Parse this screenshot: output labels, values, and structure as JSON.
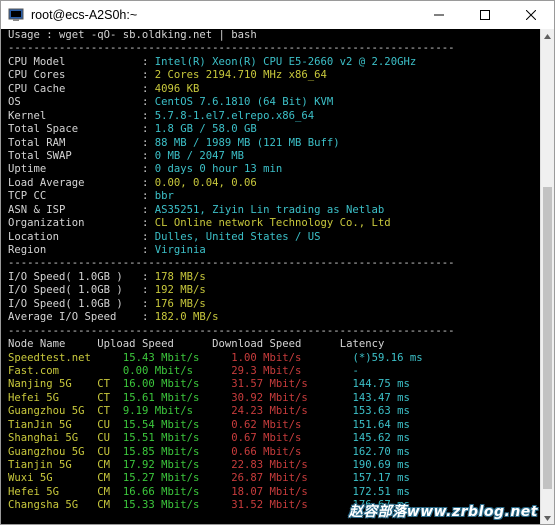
{
  "window": {
    "title": "root@ecs-A2S0h:~"
  },
  "usage": "Usage : wget -qO- sb.oldking.net | bash",
  "separator": "----------------------------------------------------------------------",
  "sysinfo": [
    {
      "label": "CPU Model",
      "value": "Intel(R) Xeon(R) CPU E5-2660 v2 @ 2.20GHz"
    },
    {
      "label": "CPU Cores",
      "value": "2 Cores 2194.710 MHz x86_64"
    },
    {
      "label": "CPU Cache",
      "value": "4096 KB"
    },
    {
      "label": "OS",
      "value": "CentOS 7.6.1810 (64 Bit) KVM"
    },
    {
      "label": "Kernel",
      "value": "5.7.8-1.el7.elrepo.x86_64"
    },
    {
      "label": "Total Space",
      "value": "1.8 GB / 58.0 GB"
    },
    {
      "label": "Total RAM",
      "value": "88 MB / 1989 MB (121 MB Buff)"
    },
    {
      "label": "Total SWAP",
      "value": "0 MB / 2047 MB"
    },
    {
      "label": "Uptime",
      "value": "0 days 0 hour 13 min"
    },
    {
      "label": "Load Average",
      "value": "0.00, 0.04, 0.06"
    },
    {
      "label": "TCP CC",
      "value": "bbr"
    },
    {
      "label": "ASN & ISP",
      "value": "AS35251, Ziyin Lin trading as Netlab"
    },
    {
      "label": "Organization",
      "value": "CL Online network Technology Co., Ltd"
    },
    {
      "label": "Location",
      "value": "Dulles, United States / US"
    },
    {
      "label": "Region",
      "value": "Virginia"
    }
  ],
  "io": [
    {
      "label": "I/O Speed( 1.0GB )",
      "value": "178 MB/s"
    },
    {
      "label": "I/O Speed( 1.0GB )",
      "value": "192 MB/s"
    },
    {
      "label": "I/O Speed( 1.0GB )",
      "value": "176 MB/s"
    },
    {
      "label": "Average I/O Speed",
      "value": "182.0 MB/s"
    }
  ],
  "speedtest": {
    "headers": [
      "Node Name",
      "Upload Speed",
      "Download Speed",
      "Latency"
    ],
    "rows": [
      {
        "node": "Speedtest.net",
        "tag": "",
        "up": "15.43 Mbit/s",
        "down": "1.00 Mbit/s",
        "lat": "(*)59.16 ms"
      },
      {
        "node": "Fast.com",
        "tag": "",
        "up": "0.00 Mbit/s",
        "down": "29.3 Mbit/s",
        "lat": "-"
      },
      {
        "node": "Nanjing 5G",
        "tag": "CT",
        "up": "16.00 Mbit/s",
        "down": "31.57 Mbit/s",
        "lat": "144.75 ms"
      },
      {
        "node": "Hefei 5G",
        "tag": "CT",
        "up": "15.61 Mbit/s",
        "down": "30.92 Mbit/s",
        "lat": "143.47 ms"
      },
      {
        "node": "Guangzhou 5G",
        "tag": "CT",
        "up": "9.19 Mbit/s",
        "down": "24.23 Mbit/s",
        "lat": "153.63 ms"
      },
      {
        "node": "TianJin 5G",
        "tag": "CU",
        "up": "15.54 Mbit/s",
        "down": "0.62 Mbit/s",
        "lat": "151.64 ms"
      },
      {
        "node": "Shanghai 5G",
        "tag": "CU",
        "up": "15.51 Mbit/s",
        "down": "0.67 Mbit/s",
        "lat": "145.62 ms"
      },
      {
        "node": "Guangzhou 5G",
        "tag": "CU",
        "up": "15.85 Mbit/s",
        "down": "0.66 Mbit/s",
        "lat": "162.70 ms"
      },
      {
        "node": "Tianjin 5G",
        "tag": "CM",
        "up": "17.92 Mbit/s",
        "down": "22.83 Mbit/s",
        "lat": "190.69 ms"
      },
      {
        "node": "Wuxi 5G",
        "tag": "CM",
        "up": "15.27 Mbit/s",
        "down": "26.87 Mbit/s",
        "lat": "157.17 ms"
      },
      {
        "node": "Hefei 5G",
        "tag": "CM",
        "up": "16.66 Mbit/s",
        "down": "18.07 Mbit/s",
        "lat": "172.51 ms"
      },
      {
        "node": "Changsha 5G",
        "tag": "CM",
        "up": "15.33 Mbit/s",
        "down": "31.52 Mbit/s",
        "lat": "176.67 ms"
      }
    ]
  },
  "watermark": "赵容部落www.zrblog.net",
  "icons": {
    "app": "putty-terminal-icon",
    "minimize": "minimize-icon",
    "maximize": "maximize-icon",
    "close": "close-icon",
    "scroll_up": "scroll-up-arrow-icon",
    "scroll_down": "scroll-down-arrow-icon"
  },
  "colors": {
    "background": "#000000",
    "label": "#d4d4d4",
    "value_cyan": "#3cc0c8",
    "value_yellow": "#c8c83c",
    "upload_green": "#3cc83c",
    "download_red": "#c83c3c"
  }
}
